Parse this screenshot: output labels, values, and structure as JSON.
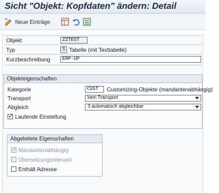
{
  "window": {
    "title": "Sicht \"Objekt: Kopfdaten\" ändern: Detail"
  },
  "toolbar": {
    "new_entries_label": "Neue Einträge",
    "icons": [
      "edit-icon",
      "table-icon",
      "undo-icon",
      "list-icon"
    ]
  },
  "header": {
    "objekt": {
      "label": "Objekt",
      "value": "ZZTEST"
    },
    "typ": {
      "label": "Typ",
      "value": "S",
      "description": "Tabelle (mit Texttabelle)"
    },
    "kurzbeschreibung": {
      "label": "Kurzbeschreibung",
      "value": "ERP-UP"
    }
  },
  "objekteigenschaften": {
    "title": "Objekteigenschaften",
    "kategorie": {
      "label": "Kategorie",
      "value": "CUST",
      "description": "Customizing-Objekte (mandantenabhängig)"
    },
    "transport": {
      "label": "Transport",
      "value": "kein Transport"
    },
    "abgleich": {
      "label": "Abgleich",
      "value": "3 automatisch abgleichbar"
    },
    "laufende_einstellung": {
      "label": "Laufende Einstellung",
      "checked": true
    }
  },
  "abgeleitete_eigenschaften": {
    "title": "Abgeleitete Eigenschaften",
    "items": [
      {
        "label": "Mandantenabhängig",
        "checked": true,
        "disabled": true
      },
      {
        "label": "Übersetzungsrelevant",
        "checked": false,
        "disabled": true
      },
      {
        "label": "Enthält Adresse",
        "checked": false,
        "disabled": false
      }
    ]
  },
  "colors": {
    "title_bg": "#dfe8f1",
    "accent": "#e4ebf2",
    "border": "#b8c6d5"
  }
}
